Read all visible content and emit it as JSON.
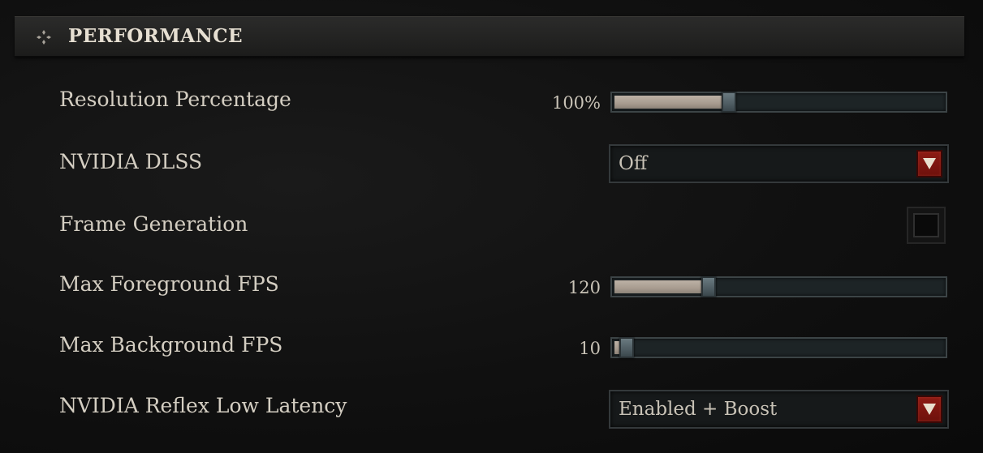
{
  "section": {
    "title": "PERFORMANCE",
    "icon": "diamond-dots-icon"
  },
  "settings": {
    "resolution_percentage": {
      "label": "Resolution Percentage",
      "value_text": "100%",
      "fill_fraction": 0.33
    },
    "nvidia_dlss": {
      "label": "NVIDIA DLSS",
      "selected": "Off"
    },
    "frame_generation": {
      "label": "Frame Generation",
      "checked": false
    },
    "max_foreground_fps": {
      "label": "Max Foreground FPS",
      "value_text": "120",
      "fill_fraction": 0.27
    },
    "max_background_fps": {
      "label": "Max Background FPS",
      "value_text": "10",
      "fill_fraction": 0.02
    },
    "nvidia_reflex": {
      "label": "NVIDIA Reflex Low Latency",
      "selected": "Enabled + Boost"
    }
  },
  "colors": {
    "accent_red": "#8d1b14",
    "slider_fill": "#bcb1a5",
    "thumb": "#5a6a70"
  }
}
